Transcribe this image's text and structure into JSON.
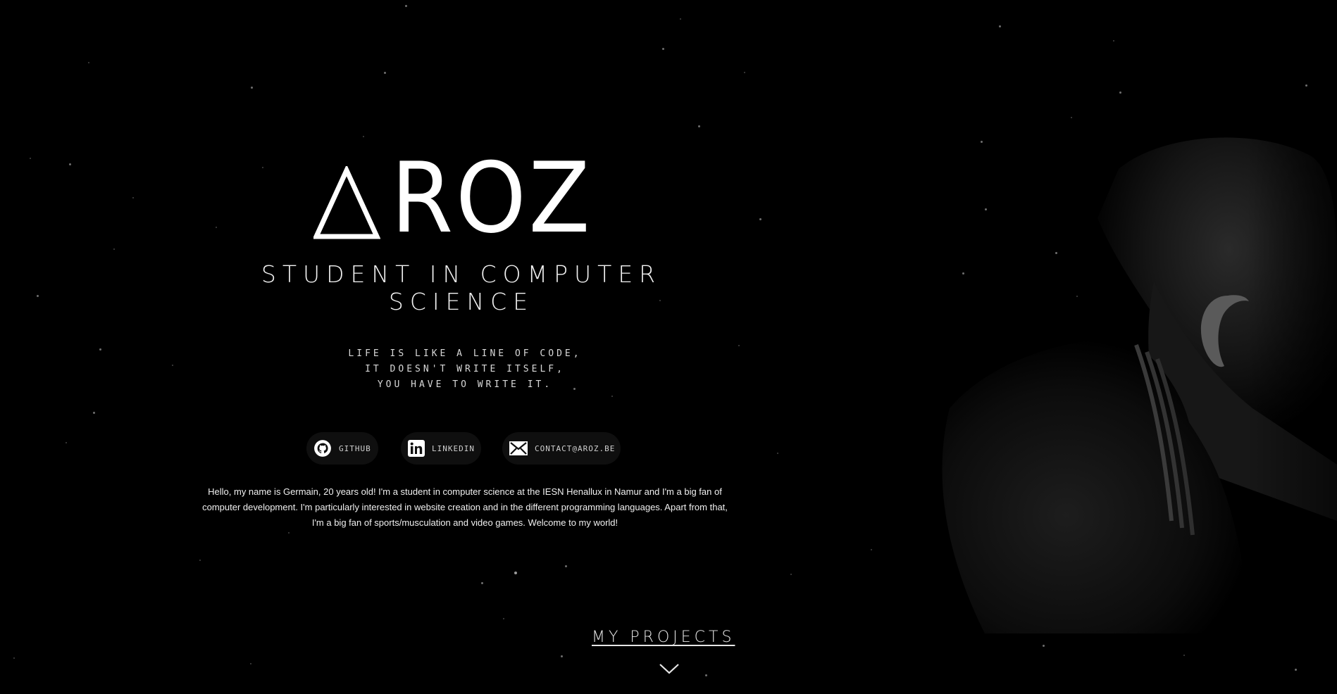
{
  "brand": {
    "logo_text": "ROZ",
    "logo_full": "AROZ"
  },
  "hero": {
    "subtitle_line1": "STUDENT IN COMPUTER",
    "subtitle_line2": "SCIENCE",
    "quote_line1": "LIFE IS LIKE A LINE OF CODE,",
    "quote_line2": "IT DOESN'T WRITE ITSELF,",
    "quote_line3": "YOU HAVE TO WRITE IT."
  },
  "socials": [
    {
      "label": "GITHUB",
      "icon": "github-icon"
    },
    {
      "label": "LINKEDIN",
      "icon": "linkedin-icon"
    },
    {
      "label": "CONTACT@AROZ.BE",
      "icon": "mail-icon"
    }
  ],
  "about": {
    "text": "Hello, my name is Germain, 20 years old! I'm a student in computer science at the IESN Henallux in Namur and I'm a big fan of computer development. I'm particularly interested in website creation and in the different programming languages. Apart from that, I'm a big fan of sports/musculation and video games. Welcome to my world!"
  },
  "navigation": {
    "projects_label": "MY PROJECTS",
    "scroll_icon": "chevron-down-icon"
  },
  "colors": {
    "background": "#000000",
    "text": "#ffffff",
    "social_bg": "#0f0f0f"
  }
}
